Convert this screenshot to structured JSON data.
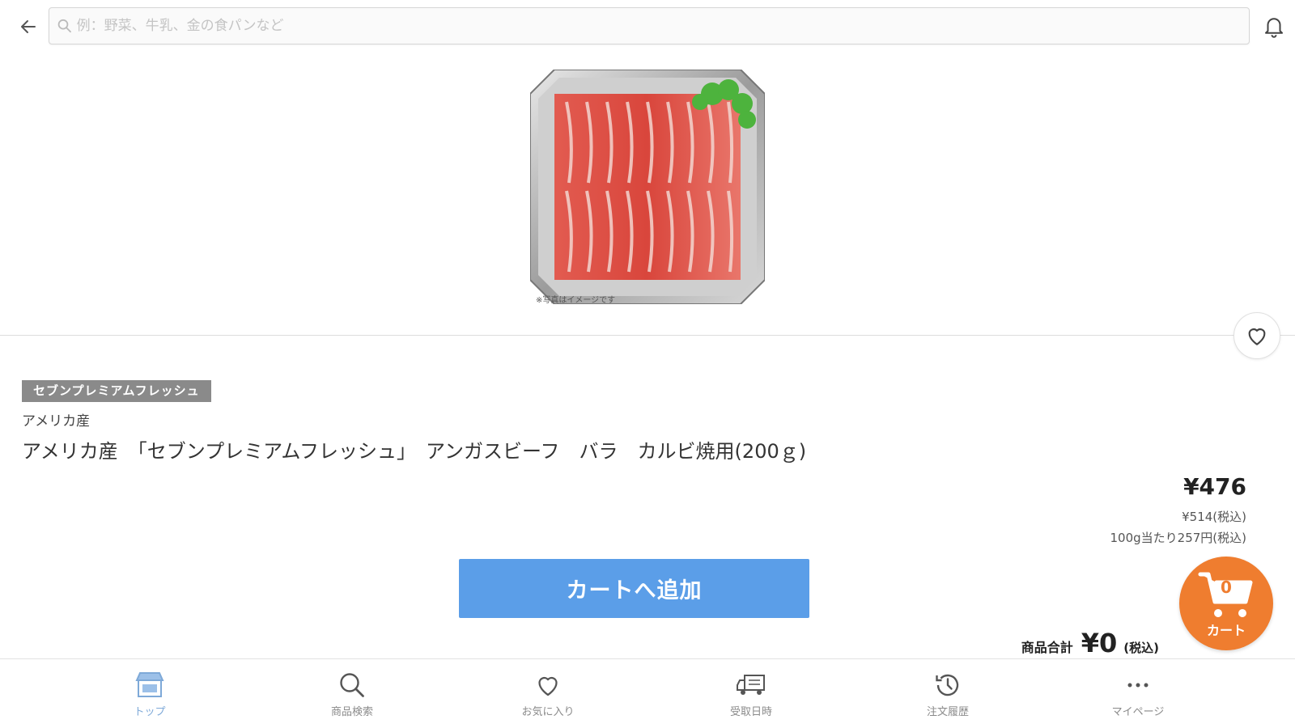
{
  "header": {
    "search_placeholder": "例：野菜、牛乳、金の食パンなど"
  },
  "product": {
    "image_caption": "※写真はイメージです",
    "brand_badge": "セブンプレミアムフレッシュ",
    "origin": "アメリカ産",
    "name": "アメリカ産　「セブンプレミアムフレッシュ」　アンガスビーフ　バラ　カルビ焼用(200ｇ)",
    "price": "¥476",
    "price_tax_included": "¥514(税込)",
    "price_per_100g": "100g当たり257円(税込)",
    "add_to_cart_label": "カートへ追加"
  },
  "subtotal": {
    "label": "商品合計",
    "amount": "¥0",
    "tax_note": "(税込)"
  },
  "cart": {
    "count": "0",
    "label": "カート",
    "color": "#ef7d2f"
  },
  "nav": {
    "items": [
      {
        "label": "トップ",
        "icon": "store-icon"
      },
      {
        "label": "商品検索",
        "icon": "search-icon"
      },
      {
        "label": "お気に入り",
        "icon": "heart-icon"
      },
      {
        "label": "受取日時",
        "icon": "truck-icon"
      },
      {
        "label": "注文履歴",
        "icon": "history-icon"
      },
      {
        "label": "マイページ",
        "icon": "more-icon"
      }
    ]
  },
  "colors": {
    "accent_blue": "#5b9ee8",
    "badge_gray": "#8a8a8a",
    "active_nav": "#7ea9d8"
  }
}
